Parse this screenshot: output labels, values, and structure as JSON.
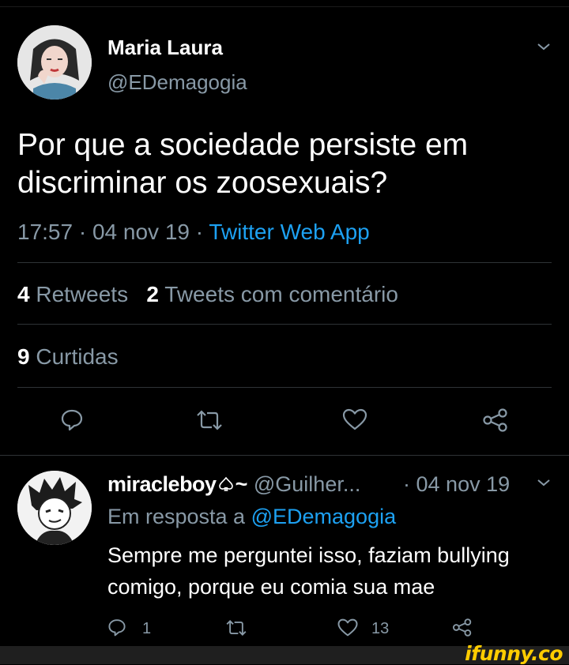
{
  "tweet": {
    "author_name": "Maria Laura",
    "author_handle": "@EDemagogia",
    "text_line1": "Por que a sociedade persiste em",
    "text_line2": "discriminar os zoosexuais?",
    "time": "17:57",
    "sep1": "·",
    "date": "04 nov 19",
    "sep2": "·",
    "source": "Twitter Web App",
    "retweets_count": "4",
    "retweets_label": "Retweets",
    "quotes_count": "2",
    "quotes_label": "Tweets com comentário",
    "likes_count": "9",
    "likes_label": "Curtidas"
  },
  "reply": {
    "author_name": "miracleboy",
    "name_suffix": "~",
    "author_handle": "@Guilher...",
    "sep": "·",
    "date": "04 nov 19",
    "in_reply_prefix": "Em resposta a",
    "in_reply_handle": "@EDemagogia",
    "text_line1": "Sempre me perguntei isso, faziam bullying",
    "text_line2": "comigo, porque eu comia sua mae",
    "reply_count": "1",
    "like_count": "13"
  },
  "watermark": "ifunny.co",
  "colors": {
    "background": "#000000",
    "accent": "#1da1f2",
    "muted": "#8899a6",
    "divider": "#2f3336",
    "watermark": "#ffcc00"
  },
  "icons": [
    "chevron-down-icon",
    "reply-icon",
    "retweet-icon",
    "like-icon",
    "share-icon",
    "spade-icon"
  ]
}
